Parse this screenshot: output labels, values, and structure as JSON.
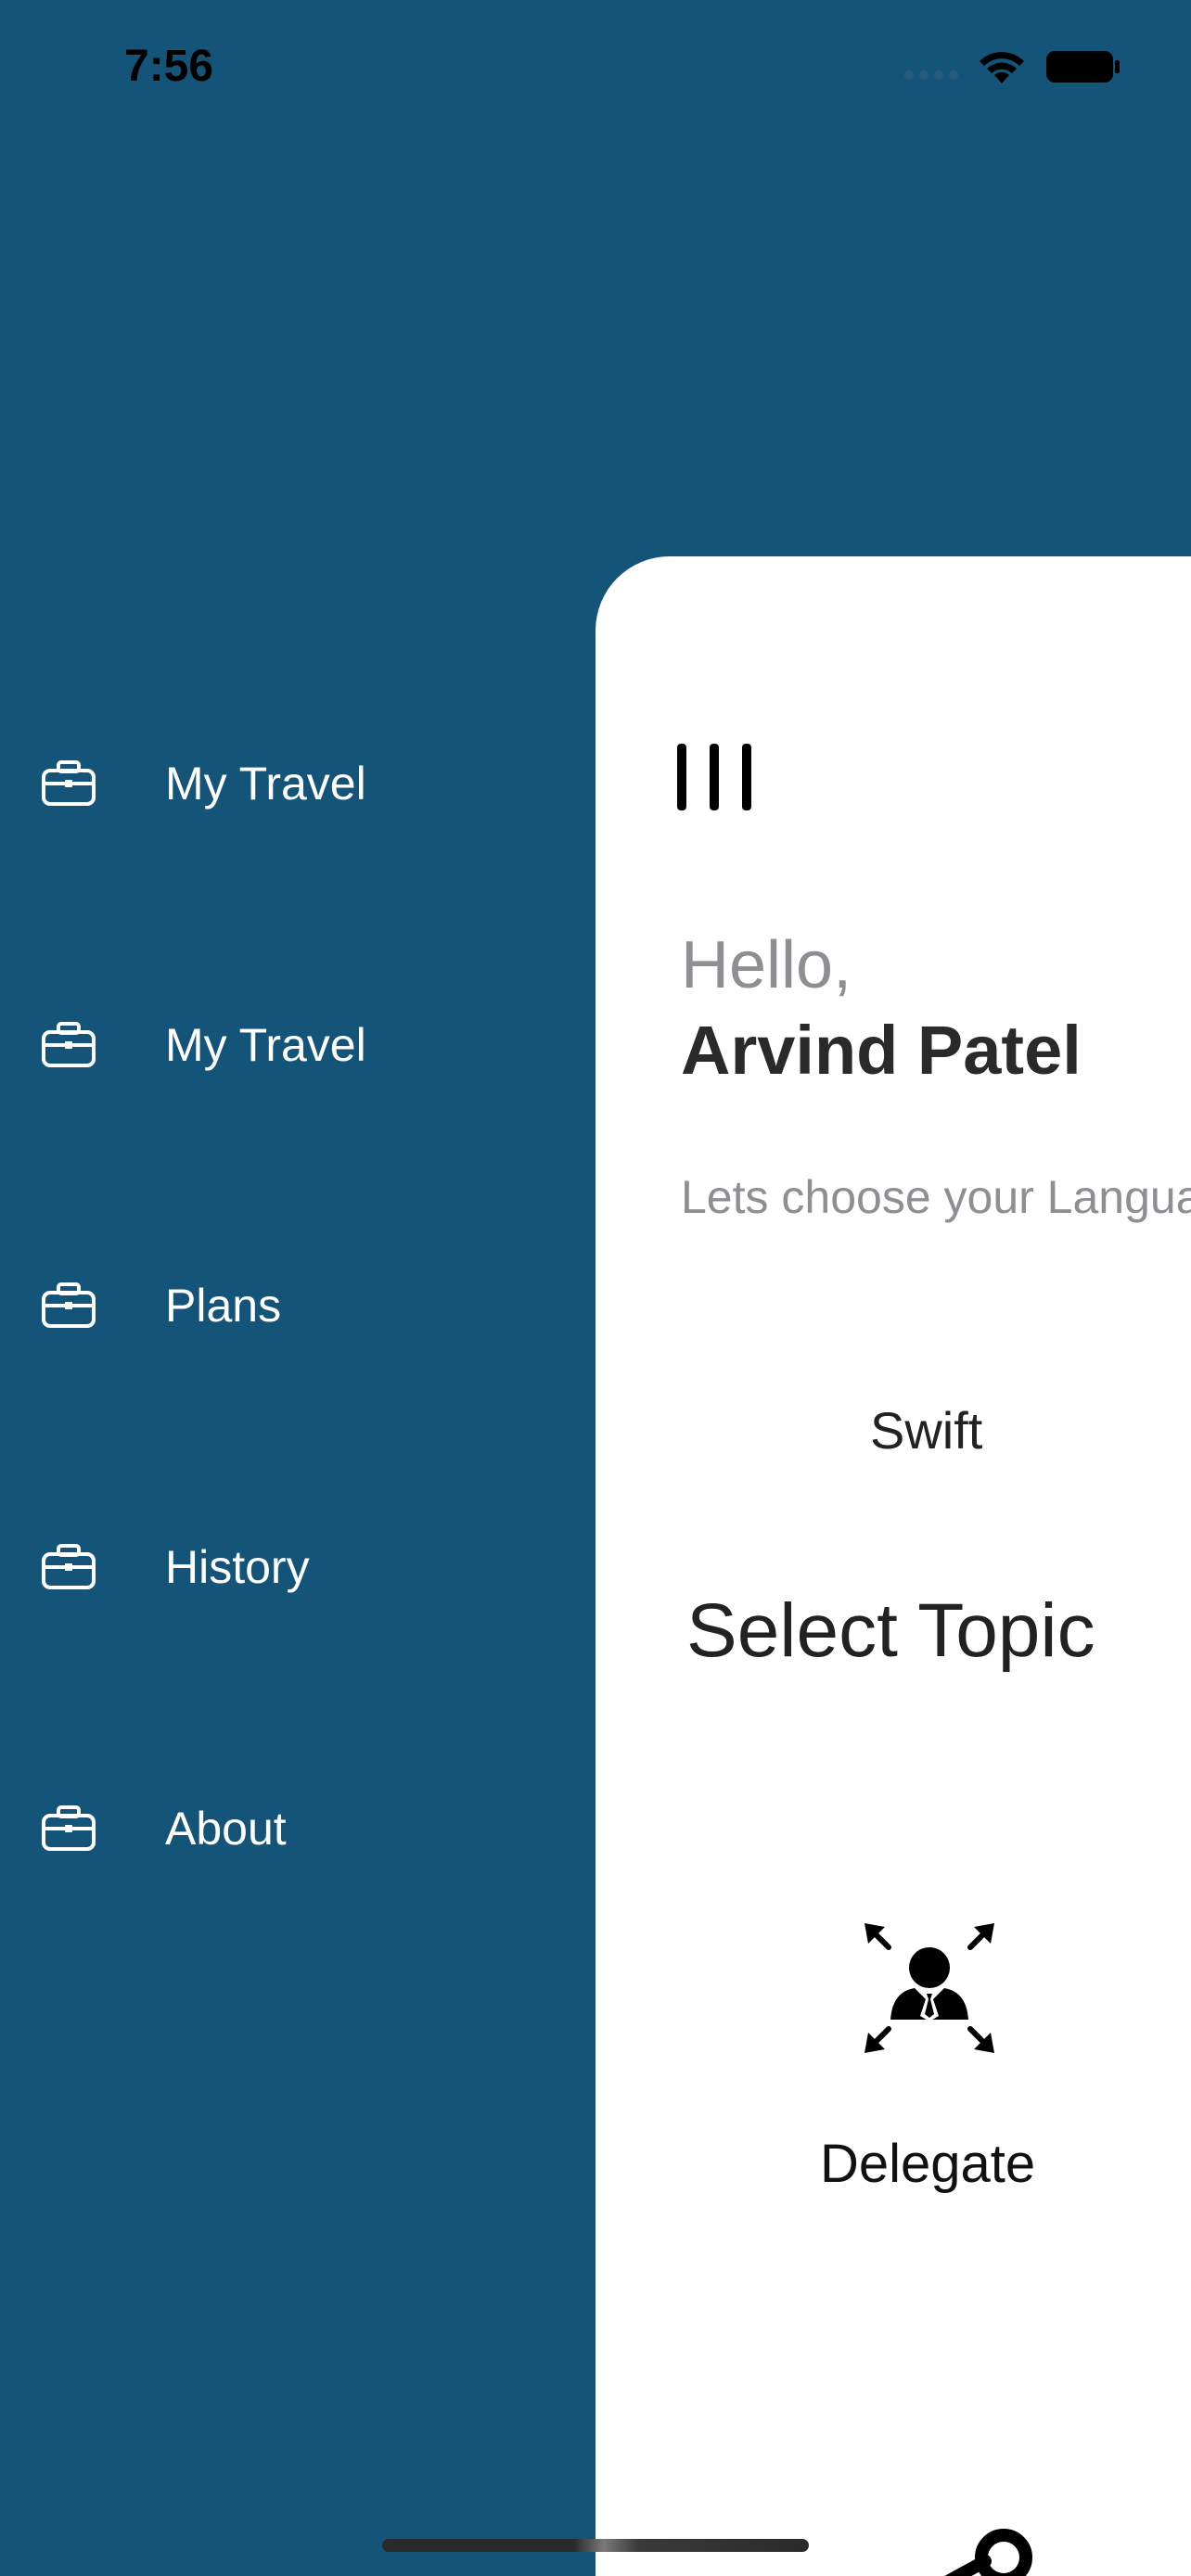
{
  "status_bar": {
    "time": "7:56"
  },
  "menu": {
    "items": [
      {
        "label": "My Travel",
        "icon": "briefcase-icon"
      },
      {
        "label": "My Travel",
        "icon": "briefcase-icon"
      },
      {
        "label": "Plans",
        "icon": "briefcase-icon"
      },
      {
        "label": "History",
        "icon": "briefcase-icon"
      },
      {
        "label": "About",
        "icon": "briefcase-icon"
      }
    ]
  },
  "main": {
    "greeting": "Hello,",
    "user_name": "Arvind Patel",
    "subtitle": "Lets choose your Langua",
    "language": "Swift",
    "section_title": "Select Topic",
    "topics": [
      {
        "label": "Delegate",
        "icon": "delegate-icon"
      }
    ]
  },
  "colors": {
    "menu_background": "#145479",
    "card_background": "#ffffff",
    "menu_text": "#ffffff",
    "muted_text": "#8e8e93",
    "dark_text": "#2a2a2a"
  }
}
